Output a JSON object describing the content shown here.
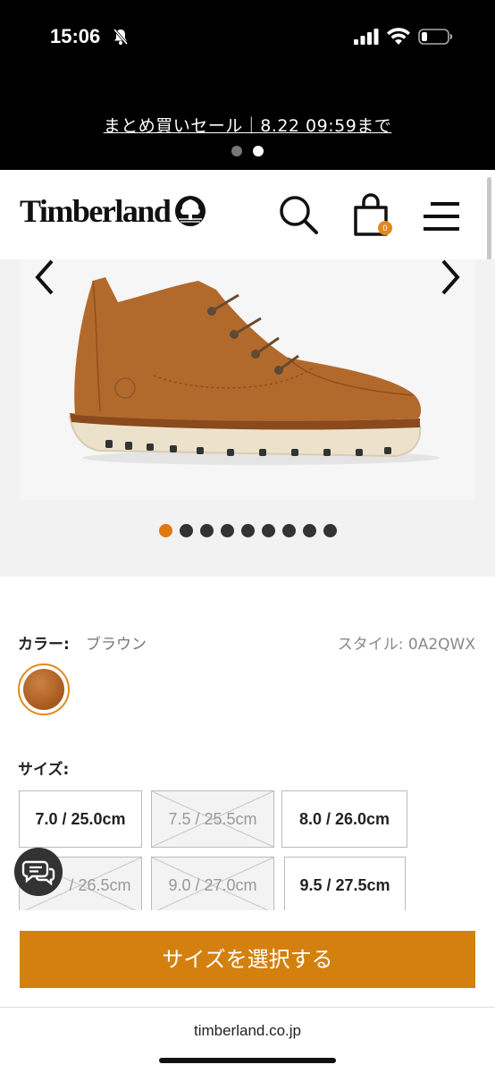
{
  "status_bar": {
    "time": "15:06",
    "icons": [
      "bell-slash-icon",
      "signal-icon",
      "wifi-icon",
      "battery-icon"
    ]
  },
  "promo": {
    "text": "まとめ買いセール｜8.22 09:59まで",
    "dots": 2,
    "active_dot": 2
  },
  "header": {
    "logo": "Timberland",
    "icons": [
      "tree-logo-icon",
      "search-icon",
      "shopping-bag-icon",
      "menu-icon"
    ],
    "cart_count": "0"
  },
  "gallery": {
    "image": "brown-chukka-boot",
    "image_count": 9,
    "active_index": 1,
    "icons": [
      "chevron-left-icon",
      "chevron-right-icon"
    ]
  },
  "product": {
    "color_label": "カラー:",
    "color_value": "ブラウン",
    "style_text": "スタイル: 0A2QWX",
    "swatch_color": "#a8581f"
  },
  "sizes": {
    "label": "サイズ:",
    "options": [
      {
        "label": "7.0 / 25.0cm",
        "available": true
      },
      {
        "label": "7.5 / 25.5cm",
        "available": false
      },
      {
        "label": "8.0 / 26.0cm",
        "available": true
      },
      {
        "label": "/ 26.5cm",
        "available": false
      },
      {
        "label": "9.0 / 27.0cm",
        "available": false
      },
      {
        "label": "9.5 / 27.5cm",
        "available": true
      }
    ]
  },
  "chat": {
    "icon": "chat-bubbles-icon"
  },
  "cta": {
    "label": "サイズを選択する",
    "color": "#d4800f"
  },
  "browser": {
    "url": "timberland.co.jp"
  },
  "colors": {
    "accent": "#e0780c",
    "cta": "#d4800f",
    "black": "#000000"
  }
}
